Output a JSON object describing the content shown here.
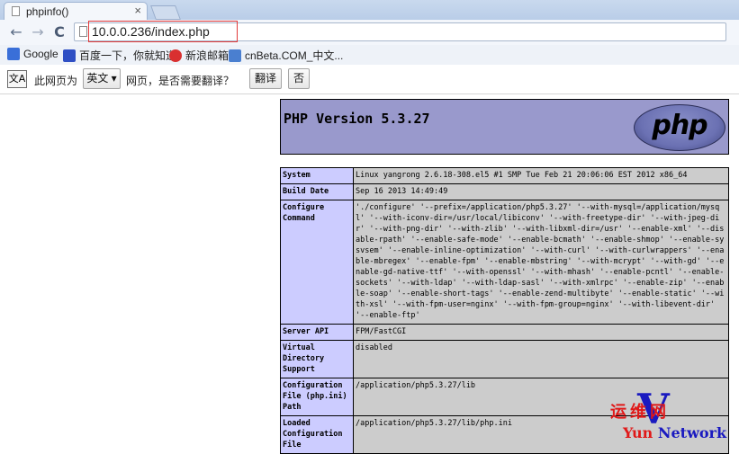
{
  "browser": {
    "tab": {
      "title": "phpinfo()",
      "close": "×"
    },
    "nav": {
      "back": "←",
      "forward": "→",
      "reload": "C"
    },
    "omnibox": {
      "url": "10.0.0.236/index.php"
    },
    "bookmarks": [
      {
        "label": "Google",
        "color": "#3a6fd8"
      },
      {
        "label": "百度一下，你就知道",
        "color": "#2f4fc4"
      },
      {
        "label": "新浪邮箱",
        "color": "#d93030"
      },
      {
        "label": "cnBeta.COM_中文...",
        "color": "#4a7fd0"
      }
    ]
  },
  "translate_bar": {
    "icon": "文A",
    "prefix": "此网页为",
    "language": "英文",
    "suffix": "网页，是否需要翻译？",
    "translate_button": "翻译",
    "no_button": "否"
  },
  "phpinfo": {
    "version_title": "PHP Version 5.3.27",
    "logo_text": "php",
    "rows": [
      {
        "key": "System",
        "value": "Linux yangrong 2.6.18-308.el5 #1 SMP Tue Feb 21 20:06:06 EST 2012 x86_64"
      },
      {
        "key": "Build Date",
        "value": "Sep 16 2013 14:49:49"
      },
      {
        "key": "Configure Command",
        "value": "'./configure' '--prefix=/application/php5.3.27' '--with-mysql=/application/mysql' '--with-iconv-dir=/usr/local/libiconv' '--with-freetype-dir' '--with-jpeg-dir' '--with-png-dir' '--with-zlib' '--with-libxml-dir=/usr' '--enable-xml' '--disable-rpath' '--enable-safe-mode' '--enable-bcmath' '--enable-shmop' '--enable-sysvsem' '--enable-inline-optimization' '--with-curl' '--with-curlwrappers' '--enable-mbregex' '--enable-fpm' '--enable-mbstring' '--with-mcrypt' '--with-gd' '--enable-gd-native-ttf' '--with-openssl' '--with-mhash' '--enable-pcntl' '--enable-sockets' '--with-ldap' '--with-ldap-sasl' '--with-xmlrpc' '--enable-zip' '--enable-soap' '--enable-short-tags' '--enable-zend-multibyte' '--enable-static' '--with-xsl' '--with-fpm-user=nginx' '--with-fpm-group=nginx' '--with-libevent-dir' '--enable-ftp'"
      },
      {
        "key": "Server API",
        "value": "FPM/FastCGI"
      },
      {
        "key": "Virtual Directory Support",
        "value": "disabled"
      },
      {
        "key": "Configuration File (php.ini) Path",
        "value": "/application/php5.3.27/lib"
      },
      {
        "key": "Loaded Configuration File",
        "value": "/application/php5.3.27/lib/php.ini"
      }
    ]
  },
  "watermark": {
    "top": "运维网",
    "bottom_left": "Yun",
    "bottom_right": "Network"
  }
}
